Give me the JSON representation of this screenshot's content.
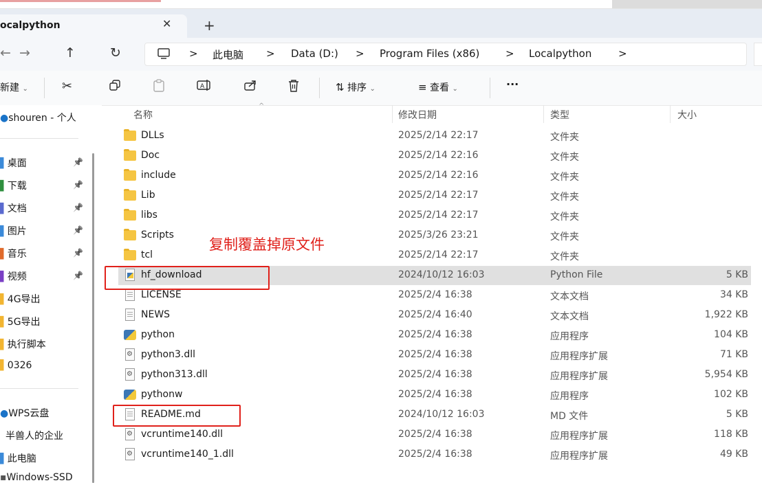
{
  "tab": {
    "title": "ocalpython",
    "close": "✕",
    "new_tab": "+"
  },
  "nav": {
    "back": "←",
    "forward": "→",
    "up": "↑",
    "refresh": "↻",
    "breadcrumb": [
      "此电脑",
      "Data (D:)",
      "Program Files (x86)",
      "Localpython"
    ],
    "sep": ">"
  },
  "toolbar": {
    "new_label": "新建",
    "sort_label": "排序",
    "view_label": "查看",
    "more": "···"
  },
  "sidebar": {
    "top": "shouren - 个人",
    "quick": [
      {
        "label": "桌面",
        "pinned": true
      },
      {
        "label": "下载",
        "pinned": true
      },
      {
        "label": "文档",
        "pinned": true
      },
      {
        "label": "图片",
        "pinned": true
      },
      {
        "label": "音乐",
        "pinned": true
      },
      {
        "label": "视频",
        "pinned": true
      },
      {
        "label": "4G导出",
        "pinned": false
      },
      {
        "label": "5G导出",
        "pinned": false
      },
      {
        "label": "执行脚本",
        "pinned": false
      },
      {
        "label": "0326",
        "pinned": false
      }
    ],
    "wps": "WPS云盘",
    "enterprise": "半兽人的企业",
    "pc": "此电脑",
    "drive": "Windows-SSD"
  },
  "columns": {
    "name": "名称",
    "date": "修改日期",
    "type": "类型",
    "size": "大小"
  },
  "files": [
    {
      "name": "DLLs",
      "date": "2025/2/14 22:17",
      "type": "文件夹",
      "size": "",
      "icon": "folder"
    },
    {
      "name": "Doc",
      "date": "2025/2/14 22:16",
      "type": "文件夹",
      "size": "",
      "icon": "folder"
    },
    {
      "name": "include",
      "date": "2025/2/14 22:16",
      "type": "文件夹",
      "size": "",
      "icon": "folder"
    },
    {
      "name": "Lib",
      "date": "2025/2/14 22:17",
      "type": "文件夹",
      "size": "",
      "icon": "folder"
    },
    {
      "name": "libs",
      "date": "2025/2/14 22:17",
      "type": "文件夹",
      "size": "",
      "icon": "folder"
    },
    {
      "name": "Scripts",
      "date": "2025/3/26 23:21",
      "type": "文件夹",
      "size": "",
      "icon": "folder"
    },
    {
      "name": "tcl",
      "date": "2025/2/14 22:17",
      "type": "文件夹",
      "size": "",
      "icon": "folder"
    },
    {
      "name": "hf_download",
      "date": "2024/10/12 16:03",
      "type": "Python File",
      "size": "5 KB",
      "icon": "python-file",
      "selected": true
    },
    {
      "name": "LICENSE",
      "date": "2025/2/4 16:38",
      "type": "文本文档",
      "size": "34 KB",
      "icon": "text-document"
    },
    {
      "name": "NEWS",
      "date": "2025/2/4 16:40",
      "type": "文本文档",
      "size": "1,922 KB",
      "icon": "text-document"
    },
    {
      "name": "python",
      "date": "2025/2/4 16:38",
      "type": "应用程序",
      "size": "104 KB",
      "icon": "python-app"
    },
    {
      "name": "python3.dll",
      "date": "2025/2/4 16:38",
      "type": "应用程序扩展",
      "size": "71 KB",
      "icon": "dll"
    },
    {
      "name": "python313.dll",
      "date": "2025/2/4 16:38",
      "type": "应用程序扩展",
      "size": "5,954 KB",
      "icon": "dll"
    },
    {
      "name": "pythonw",
      "date": "2025/2/4 16:38",
      "type": "应用程序",
      "size": "102 KB",
      "icon": "python-app"
    },
    {
      "name": "README.md",
      "date": "2024/10/12 16:03",
      "type": "MD 文件",
      "size": "5 KB",
      "icon": "blank-document"
    },
    {
      "name": "vcruntime140.dll",
      "date": "2025/2/4 16:38",
      "type": "应用程序扩展",
      "size": "118 KB",
      "icon": "dll"
    },
    {
      "name": "vcruntime140_1.dll",
      "date": "2025/2/4 16:38",
      "type": "应用程序扩展",
      "size": "49 KB",
      "icon": "dll"
    }
  ],
  "annotation": {
    "text": "复制覆盖掉原文件",
    "color": "#e0201a"
  },
  "colors": {
    "accent_red": "#e0201a",
    "selection": "#e0e0e0",
    "folder": "#f5c542"
  }
}
